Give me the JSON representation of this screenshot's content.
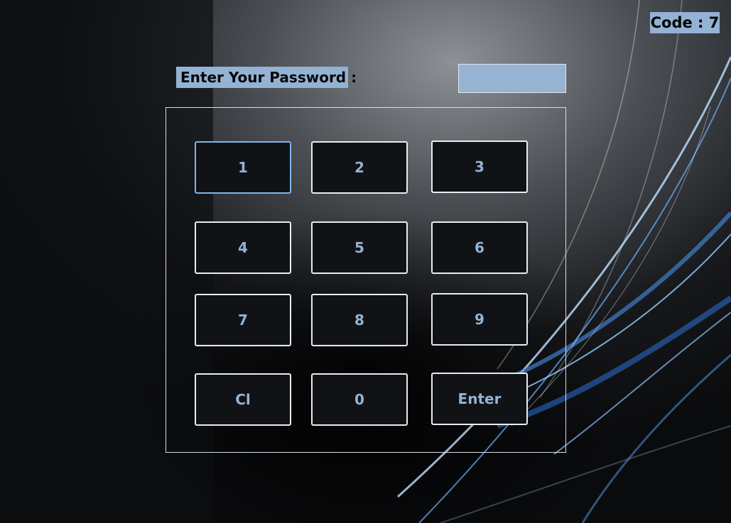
{
  "code_label": "Code : 7",
  "password_prompt": "Enter Your Password :",
  "password_input": {
    "value": "",
    "placeholder": ""
  },
  "keypad": {
    "keys": [
      "1",
      "2",
      "3",
      "4",
      "5",
      "6",
      "7",
      "8",
      "9",
      "Cl",
      "0",
      "Enter"
    ]
  },
  "colors": {
    "label_background": "#94b2d3",
    "key_text": "#94b2d3",
    "key_background": "#101216",
    "key_border": "#e9ecef",
    "focused_key_border": "#7fb6ea"
  }
}
